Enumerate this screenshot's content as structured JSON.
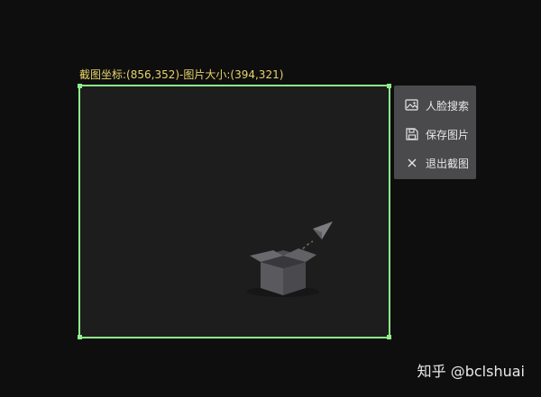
{
  "capture": {
    "info_label": "截图坐标:(856,352)-图片大小:(394,321)"
  },
  "toolbar": {
    "items": [
      {
        "label": "人脸搜索",
        "icon": "image-search-icon"
      },
      {
        "label": "保存图片",
        "icon": "save-icon"
      },
      {
        "label": "退出截图",
        "icon": "close-icon"
      }
    ]
  },
  "watermark": {
    "text": "知乎 @bclshuai"
  },
  "colors": {
    "selection_border": "#8ff08a",
    "label_text": "#e8d36a",
    "toolbar_bg": "#4a4a4c",
    "background": "#0e0e0e"
  }
}
